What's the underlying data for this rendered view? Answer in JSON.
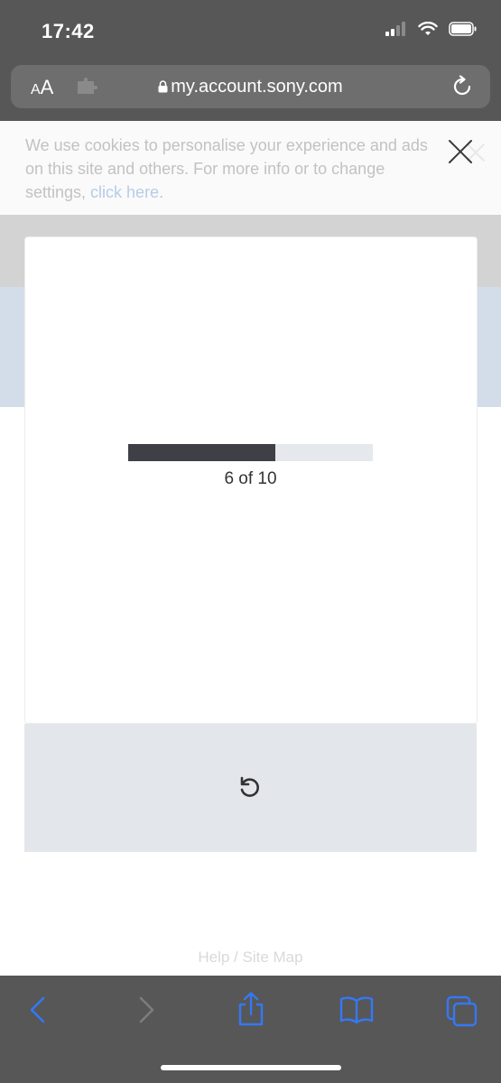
{
  "status_bar": {
    "time": "17:42"
  },
  "browser": {
    "text_size_label": "AA",
    "url": "my.account.sony.com"
  },
  "cookie_banner": {
    "text": "We use cookies to personalise your experience and ads on this site and others. For more info or to change settings, ",
    "link_text": "click here",
    "trailing_text": "."
  },
  "progress": {
    "value": 6,
    "total": 10,
    "label": "6 of 10"
  },
  "footer": {
    "link_text": "Help / Site Map"
  },
  "colors": {
    "chrome": "#575757",
    "link_accent": "#3478f6",
    "progress_fill": "#3f4047",
    "progress_track": "#e5e8ec"
  }
}
